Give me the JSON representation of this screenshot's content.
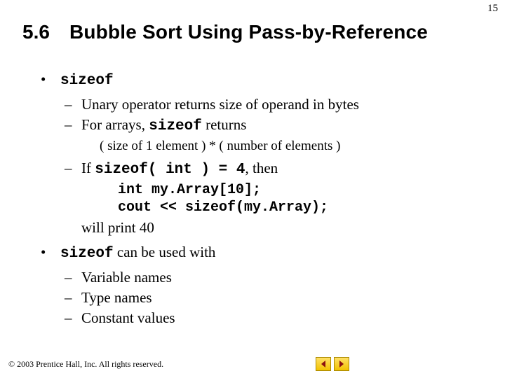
{
  "page_number": "15",
  "heading": {
    "number": "5.6",
    "title": "Bubble Sort Using Pass-by-Reference"
  },
  "bullets": [
    {
      "prefix_code": "sizeof",
      "suffix_text": ""
    },
    {
      "prefix_code": "sizeof",
      "suffix_text": " can be used with"
    }
  ],
  "dash1": [
    {
      "text": "Unary operator returns size of operand in bytes"
    },
    {
      "prefix": "For arrays, ",
      "code": "sizeof",
      "suffix": " returns"
    },
    {
      "prefix": "If ",
      "code": "sizeof( int ) = 4",
      "suffix": ", then"
    }
  ],
  "formula": "( size of 1 element ) * ( number of elements )",
  "codeblock": [
    "int my.Array[10];",
    "cout << sizeof(my.Array);"
  ],
  "trail": "will print 40",
  "dash2": [
    "Variable names",
    "Type names",
    "Constant values"
  ],
  "footer": {
    "copyright_symbol": "©",
    "copyright_text": "2003 Prentice Hall, Inc.  All rights reserved."
  }
}
